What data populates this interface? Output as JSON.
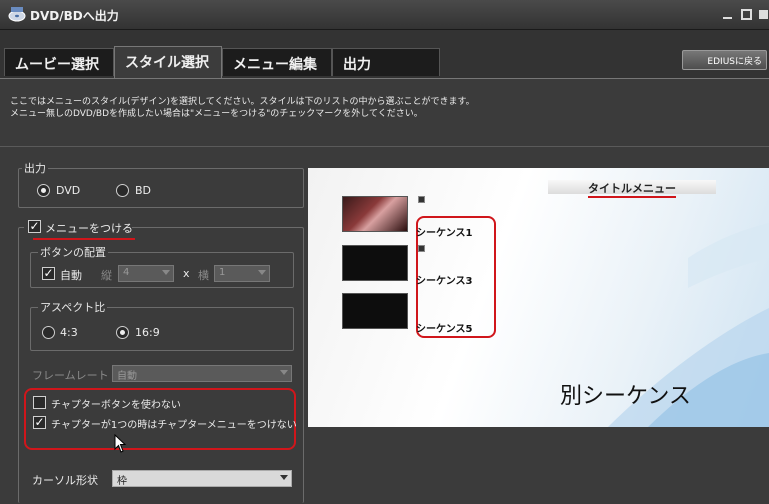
{
  "window": {
    "title": "DVD/BDへ出力"
  },
  "tabs": [
    {
      "label": "ムービー選択"
    },
    {
      "label": "スタイル選択"
    },
    {
      "label": "メニュー編集"
    },
    {
      "label": "出力"
    }
  ],
  "edius_button": "EDIUSに戻る",
  "description": [
    "ここではメニューのスタイル(デザイン)を選択してください。スタイルは下のリストの中から選ぶことができます。",
    "メニュー無しのDVD/BDを作成したい場合は\"メニューをつける\"のチェックマークを外してください。"
  ],
  "output_group": {
    "label": "出力",
    "dvd": "DVD",
    "bd": "BD",
    "selected": "DVD"
  },
  "menu_check": {
    "label": "メニューをつける",
    "checked": true
  },
  "button_layout": {
    "label": "ボタンの配置",
    "auto": "自動",
    "vertical_label": "縦",
    "vertical_value": "4",
    "x_label": "x",
    "horizontal_label": "横",
    "horizontal_value": "1"
  },
  "aspect": {
    "label": "アスペクト比",
    "opt1": "4:3",
    "opt2": "16:9",
    "selected": "16:9"
  },
  "frame_rate": {
    "label": "フレームレート",
    "value": "自動"
  },
  "chapter_options": [
    {
      "label": "チャプターボタンを使わない",
      "checked": false
    },
    {
      "label": "チャプターが1つの時はチャプターメニューをつけない",
      "checked": true
    }
  ],
  "cursor": {
    "label": "カーソル形状",
    "value": "枠"
  },
  "preview": {
    "title": "タイトルメニュー",
    "items": [
      "シーケンス1",
      "シーケンス3",
      "シーケンス5"
    ],
    "big_text": "別シーケンス"
  },
  "colors": {
    "highlight": "#d0161b",
    "panel": "#3b3b3b"
  }
}
